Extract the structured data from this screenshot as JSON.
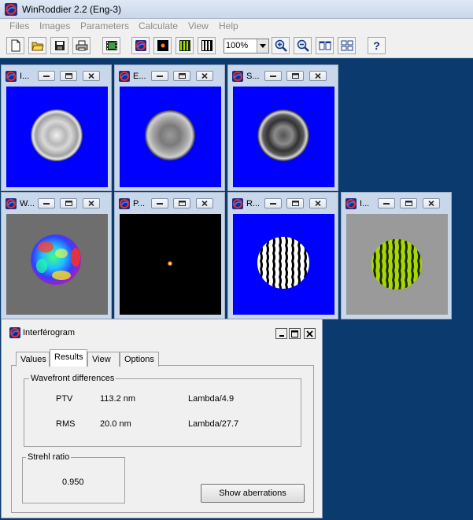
{
  "app": {
    "title": "WinRoddier 2.2 (Eng-3)"
  },
  "menu": [
    "Files",
    "Images",
    "Parameters",
    "Calculate",
    "View",
    "Help"
  ],
  "toolbar": {
    "zoom_value": "100%",
    "help_label": "?",
    "buttons": [
      "new-icon",
      "open-icon",
      "save-icon",
      "print-icon",
      "film-icon",
      "logo-icon",
      "point-icon",
      "green-fringes-icon",
      "bw-fringes-icon",
      "zoom-in-icon",
      "zoom-out-icon",
      "tile-horizontal-icon",
      "tile-grid-icon",
      "help-icon"
    ]
  },
  "child_windows": [
    {
      "title": "I...",
      "content": "blue-ring-light"
    },
    {
      "title": "E...",
      "content": "blue-ring-medium"
    },
    {
      "title": "S...",
      "content": "blue-ring-dark"
    },
    {
      "title": "W...",
      "content": "wavefront-map"
    },
    {
      "title": "P...",
      "content": "psf-point"
    },
    {
      "title": "R...",
      "content": "bw-fringes"
    },
    {
      "title": "I...",
      "content": "green-fringes"
    }
  ],
  "interferogram": {
    "title": "Interférogram",
    "tabs": [
      "Values",
      "Results",
      "View",
      "Options"
    ],
    "active_tab": "Results",
    "wavefront_group": "Wavefront differences",
    "ptv_label": "PTV",
    "ptv_value": "113.2 nm",
    "ptv_lambda": "Lambda/4.9",
    "rms_label": "RMS",
    "rms_value": "20.0 nm",
    "rms_lambda": "Lambda/27.7",
    "strehl_group": "Strehl ratio",
    "strehl_value": "0.950",
    "show_aberrations_label": "Show aberrations"
  },
  "colors": {
    "desktop": "#0a3a6e",
    "image_blue": "#0000ff",
    "fringe_green": "#a8d800",
    "title_bar": "#c9d7ea"
  }
}
